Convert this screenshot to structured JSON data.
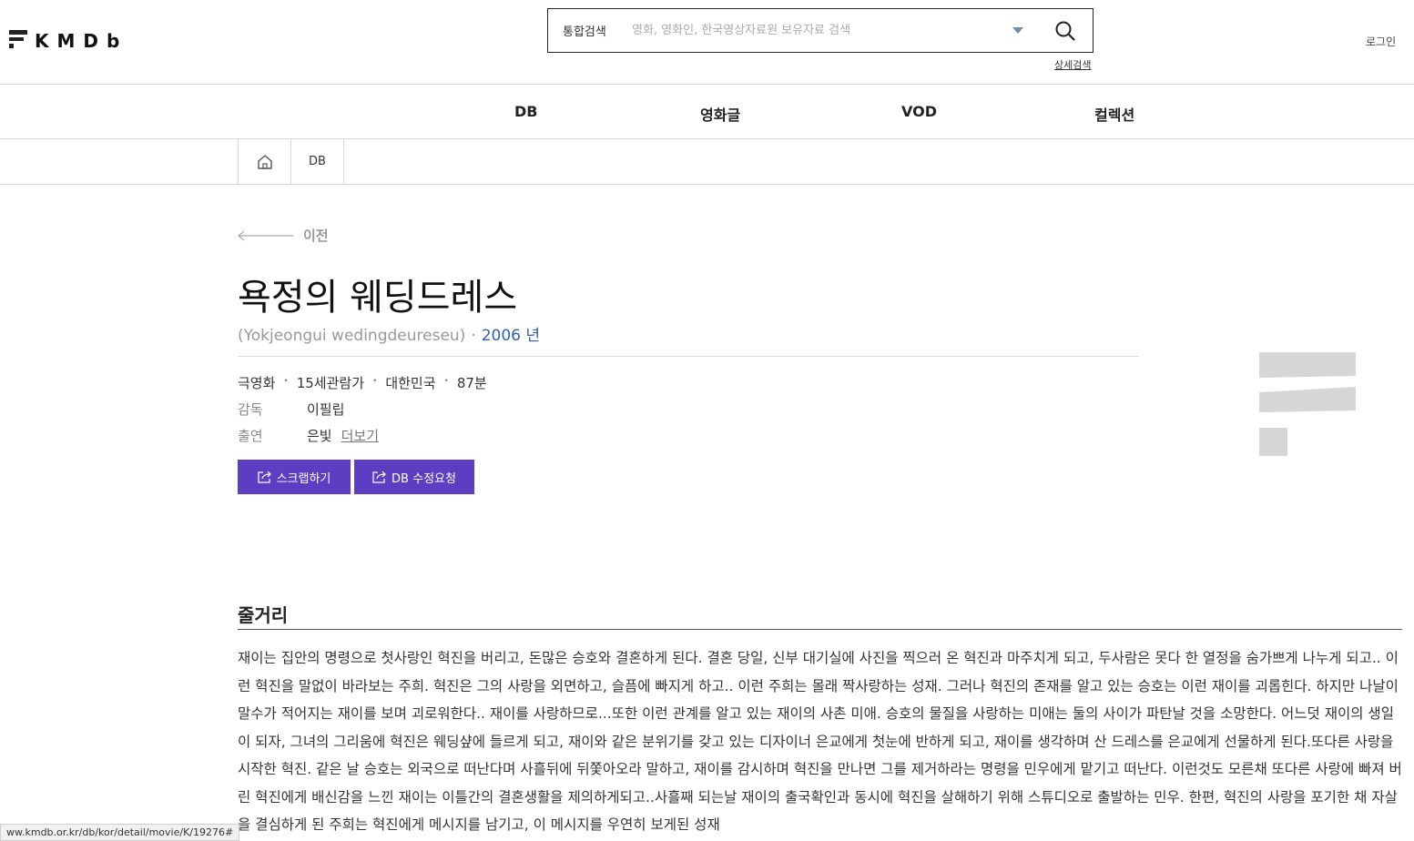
{
  "header": {
    "logo_text": "KMDb",
    "search_category": "통합검색",
    "search_placeholder": "영화, 영화인, 한국영상자료원 보유자료 검색",
    "advanced_search": "상세검색",
    "login": "로그인"
  },
  "gnb": [
    "DB",
    "영화글",
    "VOD",
    "컬렉션"
  ],
  "breadcrumb": {
    "db": "DB"
  },
  "back_label": "이전",
  "movie": {
    "title": "욕정의 웨딩드레스",
    "romanized": "(Yokjeongui wedingdeureseu)",
    "year": "2006 년",
    "meta": [
      "극영화",
      "15세관람가",
      "대한민국",
      "87분"
    ],
    "director_label": "감독",
    "director": "이필립",
    "cast_label": "출연",
    "cast": "은빛",
    "more": "더보기"
  },
  "buttons": {
    "scrap": "스크랩하기",
    "edit_request": "DB 수정요청"
  },
  "synopsis": {
    "heading": "줄거리",
    "text": " 재이는 집안의 명령으로 첫사랑인 혁진을 버리고, 돈많은 승호와 결혼하게 된다. 결혼 당일, 신부 대기실에 사진을 찍으러 온 혁진과 마주치게 되고, 두사람은 못다 한 열정을 숨가쁘게 나누게 되고.. 이런 혁진을 말없이 바라보는 주희. 혁진은 그의 사랑을 외면하고, 슬픔에 빠지게 하고.. 이런 주희는 몰래 짝사랑하는 성재. 그러나 혁진의 존재를 알고 있는 승호는 이런 재이를 괴롭힌다. 하지만 나날이 말수가 적어지는 재이를 보며 괴로워한다.. 재이를 사랑하므로...또한 이런 관계를 알고 있는 재이의 사촌 미애. 승호의 물질을 사랑하는 미애는 둘의 사이가 파탄날 것을 소망한다. 어느덧 재이의 생일이 되자, 그녀의 그리움에 혁진은 웨딩샾에 들르게 되고, 재이와 같은 분위기를 갖고 있는 디자이너 은교에게 첫눈에 반하게 되고, 재이를 생각하며 산 드레스를 은교에게 선물하게 된다.또다른 사랑을 시작한 혁진. 같은 날 승호는 외국으로 떠난다며 사흘뒤에 뒤쫓아오라 말하고, 재이를 감시하며 혁진을 만나면 그를 제거하라는 명령을 민우에게 맡기고 떠난다. 이런것도 모른채 또다른 사랑에 빠져 버린 혁진에게 배신감을 느낀 재이는 이틀간의 결혼생활을 제의하게되고..사흘째 되는날 재이의 출국확인과 동시에 혁진을 살해하기 위해 스튜디오로 출발하는 민우. 한편, 혁진의 사랑을 포기한 채 자살을 결심하게 된 주희는 혁진에게 메시지를 남기고, 이 메시지를 우연히 보게된 성재"
  },
  "status_url": "ww.kmdb.or.kr/db/kor/detail/movie/K/19276#"
}
